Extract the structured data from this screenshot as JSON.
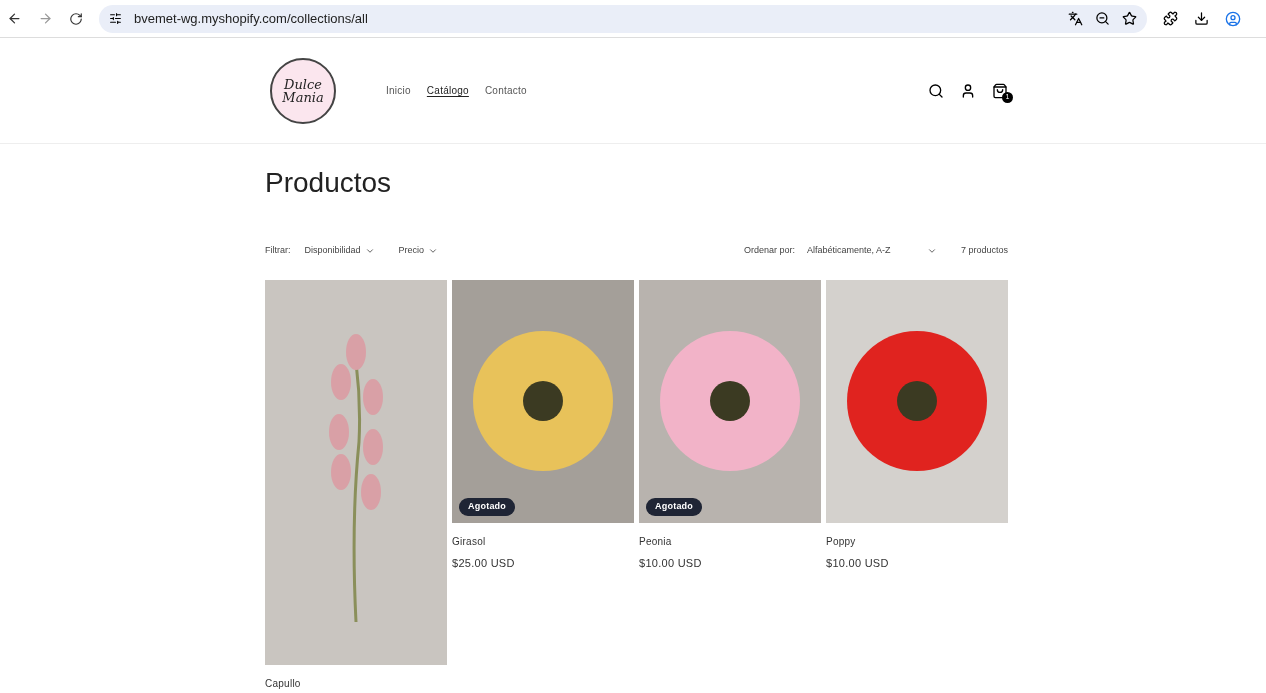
{
  "browser": {
    "url": "bvemet-wg.myshopify.com/collections/all"
  },
  "header": {
    "logo": {
      "line_1": "Dulce",
      "line_2": "Mania"
    },
    "nav": [
      {
        "label": "Inicio",
        "selected": false
      },
      {
        "label": "Catálogo",
        "selected": true
      },
      {
        "label": "Contacto",
        "selected": false
      }
    ],
    "cart_count": "1"
  },
  "title": "Productos",
  "filters": {
    "label": "Filtrar:",
    "options": [
      "Disponibilidad",
      "Precio"
    ]
  },
  "sort": {
    "label": "Ordenar por:",
    "value": "Alfabéticamente, A-Z"
  },
  "count": "7 productos",
  "products": [
    {
      "name": "Capullo",
      "kind": "tall"
    },
    {
      "name": "Girasol",
      "price": "$25.00 USD",
      "kind": "square",
      "badge": "Agotado"
    },
    {
      "name": "Peonia",
      "price": "$10.00 USD",
      "kind": "square",
      "badge": "Agotado"
    },
    {
      "name": "Poppy",
      "price": "$10.00 USD",
      "kind": "square"
    }
  ]
}
